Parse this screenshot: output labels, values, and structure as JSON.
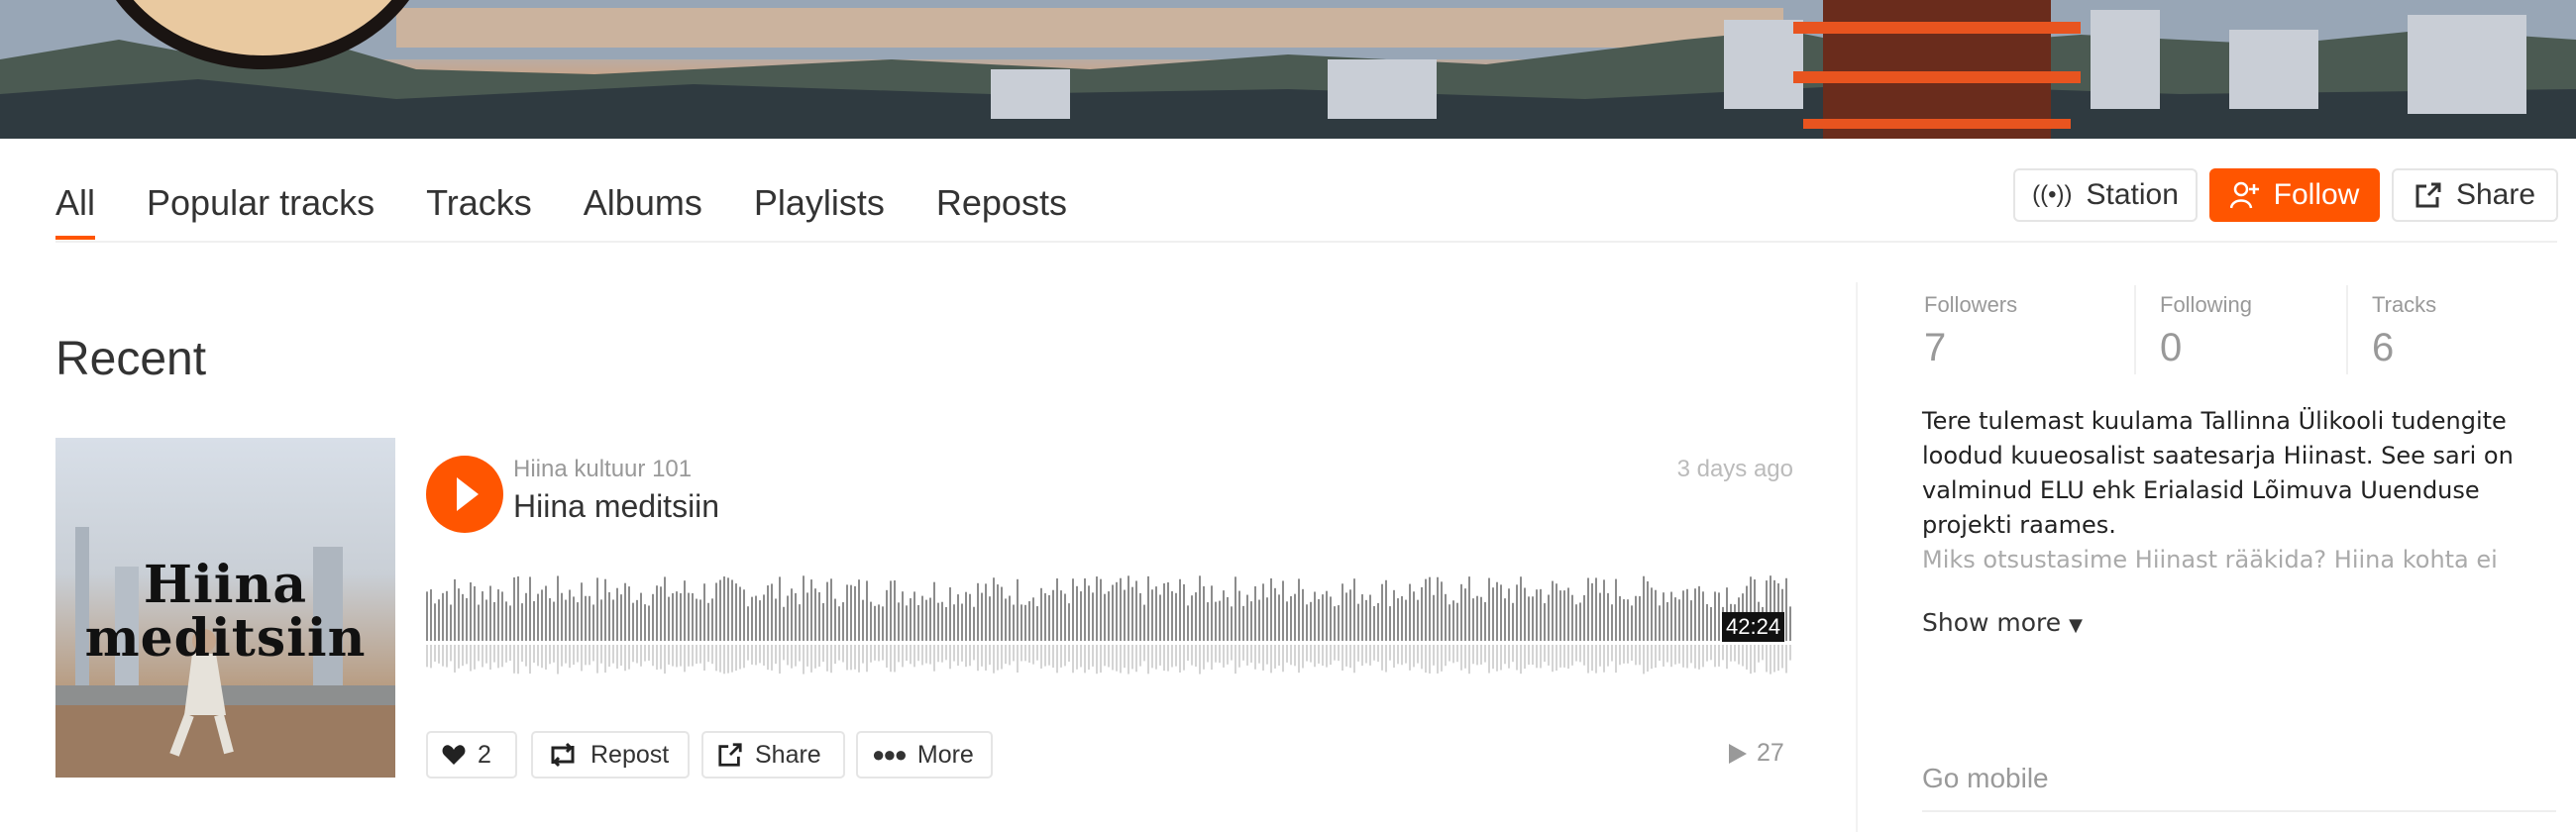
{
  "tabs": [
    "All",
    "Popular tracks",
    "Tracks",
    "Albums",
    "Playlists",
    "Reposts"
  ],
  "actions": {
    "station": "Station",
    "follow": "Follow",
    "share": "Share"
  },
  "recent": {
    "heading": "Recent",
    "track": {
      "user": "Hiina kultuur 101",
      "title": "Hiina meditsiin",
      "posted": "3 days ago",
      "artwork_text": "Hiina meditsiin",
      "duration": "42:24",
      "likes": "2",
      "repost": "Repost",
      "share": "Share",
      "more": "More",
      "plays": "27"
    }
  },
  "stats": [
    {
      "label": "Followers",
      "value": "7"
    },
    {
      "label": "Following",
      "value": "0"
    },
    {
      "label": "Tracks",
      "value": "6"
    }
  ],
  "bio": {
    "text": "Tere tulemast kuulama Tallinna Ülikooli tudengite loodud kuueosalist saatesarja Hiinast. See sari on valminud ELU ehk Erialasid Lõimuva Uuenduse projekti raames.",
    "faded": "Miks otsustasime Hiinast rääkida? Hiina kohta ei",
    "show_more": "Show more"
  },
  "go_mobile": "Go mobile",
  "colors": {
    "accent": "#ff5500"
  }
}
